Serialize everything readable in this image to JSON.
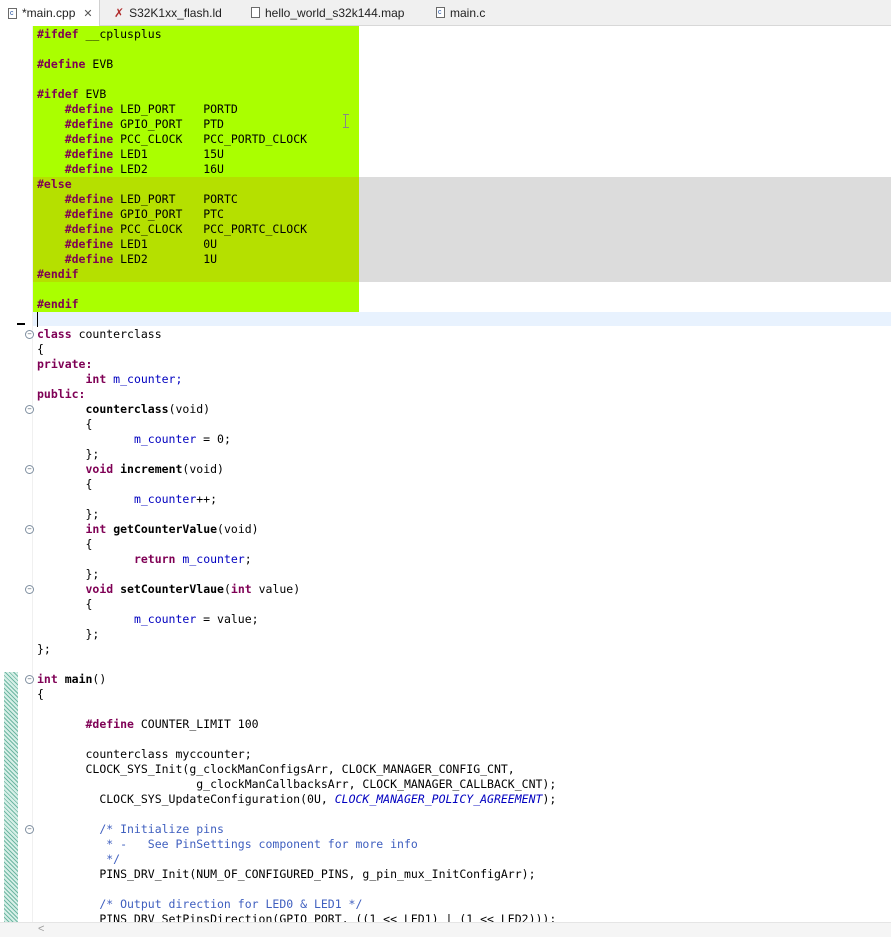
{
  "tabs": [
    {
      "label": "*main.cpp",
      "icon": "c-file-icon",
      "active": true
    },
    {
      "label": "S32K1xx_flash.ld",
      "icon": "linker-file-icon"
    },
    {
      "label": "hello_world_s32k144.map",
      "icon": "text-file-icon"
    },
    {
      "label": "main.c",
      "icon": "c-file-icon"
    }
  ],
  "tab_close": "✕",
  "scroll_left": "<",
  "code": {
    "l01": "__cplusplus",
    "l03": "EVB",
    "l05": "EVB",
    "l06": "LED_PORT    PORTD",
    "l07": "GPIO_PORT   PTD",
    "l08": "PCC_CLOCK   PCC_PORTD_CLOCK",
    "l09": "LED1        15U",
    "l10": "LED2        16U",
    "l12": "LED_PORT    PORTC",
    "l13": "GPIO_PORT   PTC",
    "l14": "PCC_CLOCK   PCC_PORTC_CLOCK",
    "l15": "LED1        0U",
    "l16": "LED2        1U",
    "l21": "counterclass",
    "l22": "{",
    "l23": "private:",
    "l24a": "int",
    "l24b": " m_counter;",
    "l25": "public:",
    "l26a": "counterclass",
    "l26b": "(void)",
    "l27": "{",
    "l28a": "m_counter",
    "l28b": " = 0;",
    "l29": "};",
    "l30a": "void",
    "l30b": "increment",
    "l30c": "(void)",
    "l31": "{",
    "l32a": "m_counter",
    "l32b": "++;",
    "l33": "};",
    "l34a": "int",
    "l34b": "getCounterValue",
    "l34c": "(void)",
    "l35": "{",
    "l36a": "return",
    "l36b": "m_counter",
    "l36c": ";",
    "l37": "};",
    "l38a": "void",
    "l38b": "setCounterVlaue",
    "l38c": "(",
    "l38d": "int",
    "l38e": " value)",
    "l39": "{",
    "l40a": "m_counter",
    "l40b": " = value;",
    "l41": "};",
    "l42": "};",
    "l44a": "int",
    "l44b": "main",
    "l44c": "()",
    "l45": "{",
    "l47": "COUNTER_LIMIT 100",
    "l49": "counterclass myccounter;",
    "l50": "CLOCK_SYS_Init(g_clockManConfigsArr, CLOCK_MANAGER_CONFIG_CNT,",
    "l51": "g_clockManCallbacksArr, CLOCK_MANAGER_CALLBACK_CNT);",
    "l52a": "CLOCK_SYS_UpdateConfiguration(0U, ",
    "l52b": "CLOCK_MANAGER_POLICY_AGREEMENT",
    "l52c": ");",
    "l54": "/* Initialize pins",
    "l55": " * -   See PinSettings component for more info",
    "l56": " */",
    "l57": "PINS_DRV_Init(NUM_OF_CONFIGURED_PINS, g_pin_mux_InitConfigArr);",
    "l59": "/* Output direction for LED0 & LED1 */",
    "l60": "PINS_DRV_SetPinsDirection(GPIO_PORT, ((1 << LED1) | (1 << LED2)));"
  },
  "kw": {
    "ifdef": "#ifdef",
    "define": "#define",
    "else": "#else",
    "endif": "#endif",
    "class": "class"
  }
}
